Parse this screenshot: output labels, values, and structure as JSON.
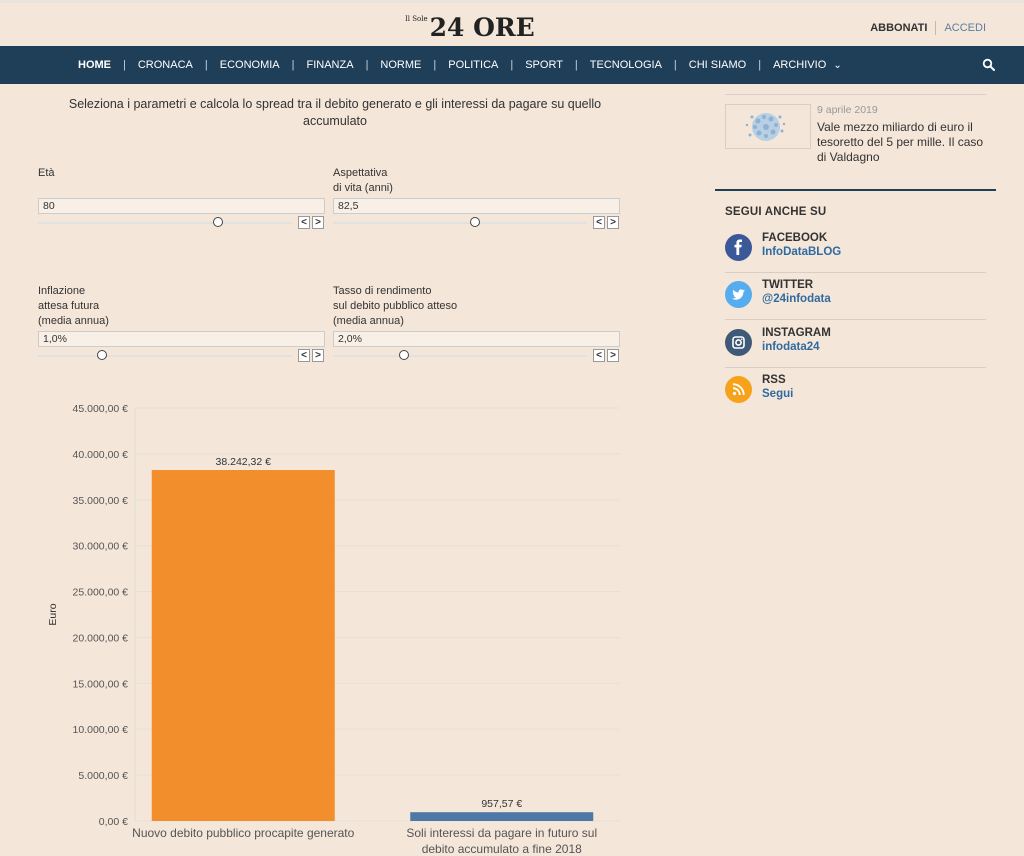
{
  "header": {
    "logo_small": "Il Sole",
    "logo_big": "24 ORE",
    "abbonati": "ABBONATI",
    "accedi": "ACCEDI"
  },
  "nav": {
    "items": [
      "HOME",
      "CRONACA",
      "ECONOMIA",
      "FINANZA",
      "NORME",
      "POLITICA",
      "SPORT",
      "TECNOLOGIA",
      "CHI SIAMO",
      "ARCHIVIO"
    ],
    "archivio_chevron": "⌄",
    "search_icon": "search-icon"
  },
  "calculator": {
    "intro": "Seleziona i parametri e calcola lo spread tra il debito generato e gli interessi da pagare su quello accumulato",
    "params": [
      {
        "label": "Età",
        "value": "80",
        "level": 0.71
      },
      {
        "label": "Aspettativa\ndi vita (anni)",
        "value": "82,5",
        "level": 0.56
      },
      {
        "label": "Inflazione\nattesa futura\n(media annua)",
        "value": "1,0%",
        "level": 0.25
      },
      {
        "label": "Tasso di rendimento\nsul debito pubblico atteso\n(media annua)",
        "value": "2,0%",
        "level": 0.28
      }
    ],
    "stepper_prev": "<",
    "stepper_next": ">"
  },
  "chart_data": {
    "type": "bar",
    "categories": [
      "Nuovo debito pubblico procapite generato",
      "Soli interessi da pagare in futuro sul debito accumulato a fine 2018"
    ],
    "category_lines": [
      [
        "Nuovo debito pubblico procapite generato"
      ],
      [
        "Soli interessi da pagare in futuro sul",
        "debito accumulato a fine 2018"
      ]
    ],
    "values": [
      38242.32,
      957.57
    ],
    "value_labels": [
      "38.242,32 €",
      "957,57 €"
    ],
    "colors": [
      "#f28e2c",
      "#4e79a7"
    ],
    "ylabel": "Euro",
    "ylim": [
      0,
      45000
    ],
    "yticks": [
      0,
      5000,
      10000,
      15000,
      20000,
      25000,
      30000,
      35000,
      40000,
      45000
    ],
    "ytick_labels": [
      "0,00 €",
      "5.000,00 €",
      "10.000,00 €",
      "15.000,00 €",
      "20.000,00 €",
      "25.000,00 €",
      "30.000,00 €",
      "35.000,00 €",
      "40.000,00 €",
      "45.000,00 €"
    ],
    "grid": true
  },
  "sidebar": {
    "article": {
      "date": "9 aprile 2019",
      "title": "Vale mezzo miliardo di euro il tesoretto del 5 per mille. Il caso di Valdagno"
    },
    "follow_title": "SEGUI ANCHE SU",
    "socials": [
      {
        "name": "FACEBOOK",
        "handle": "InfoDataBLOG",
        "color": "#3b5998",
        "icon": "facebook-icon"
      },
      {
        "name": "TWITTER",
        "handle": "@24infodata",
        "color": "#55acee",
        "icon": "twitter-icon"
      },
      {
        "name": "INSTAGRAM",
        "handle": "infodata24",
        "color": "#3f5a78",
        "icon": "instagram-icon"
      },
      {
        "name": "RSS",
        "handle": "Segui",
        "color": "#f7a21b",
        "icon": "rss-icon"
      }
    ]
  }
}
